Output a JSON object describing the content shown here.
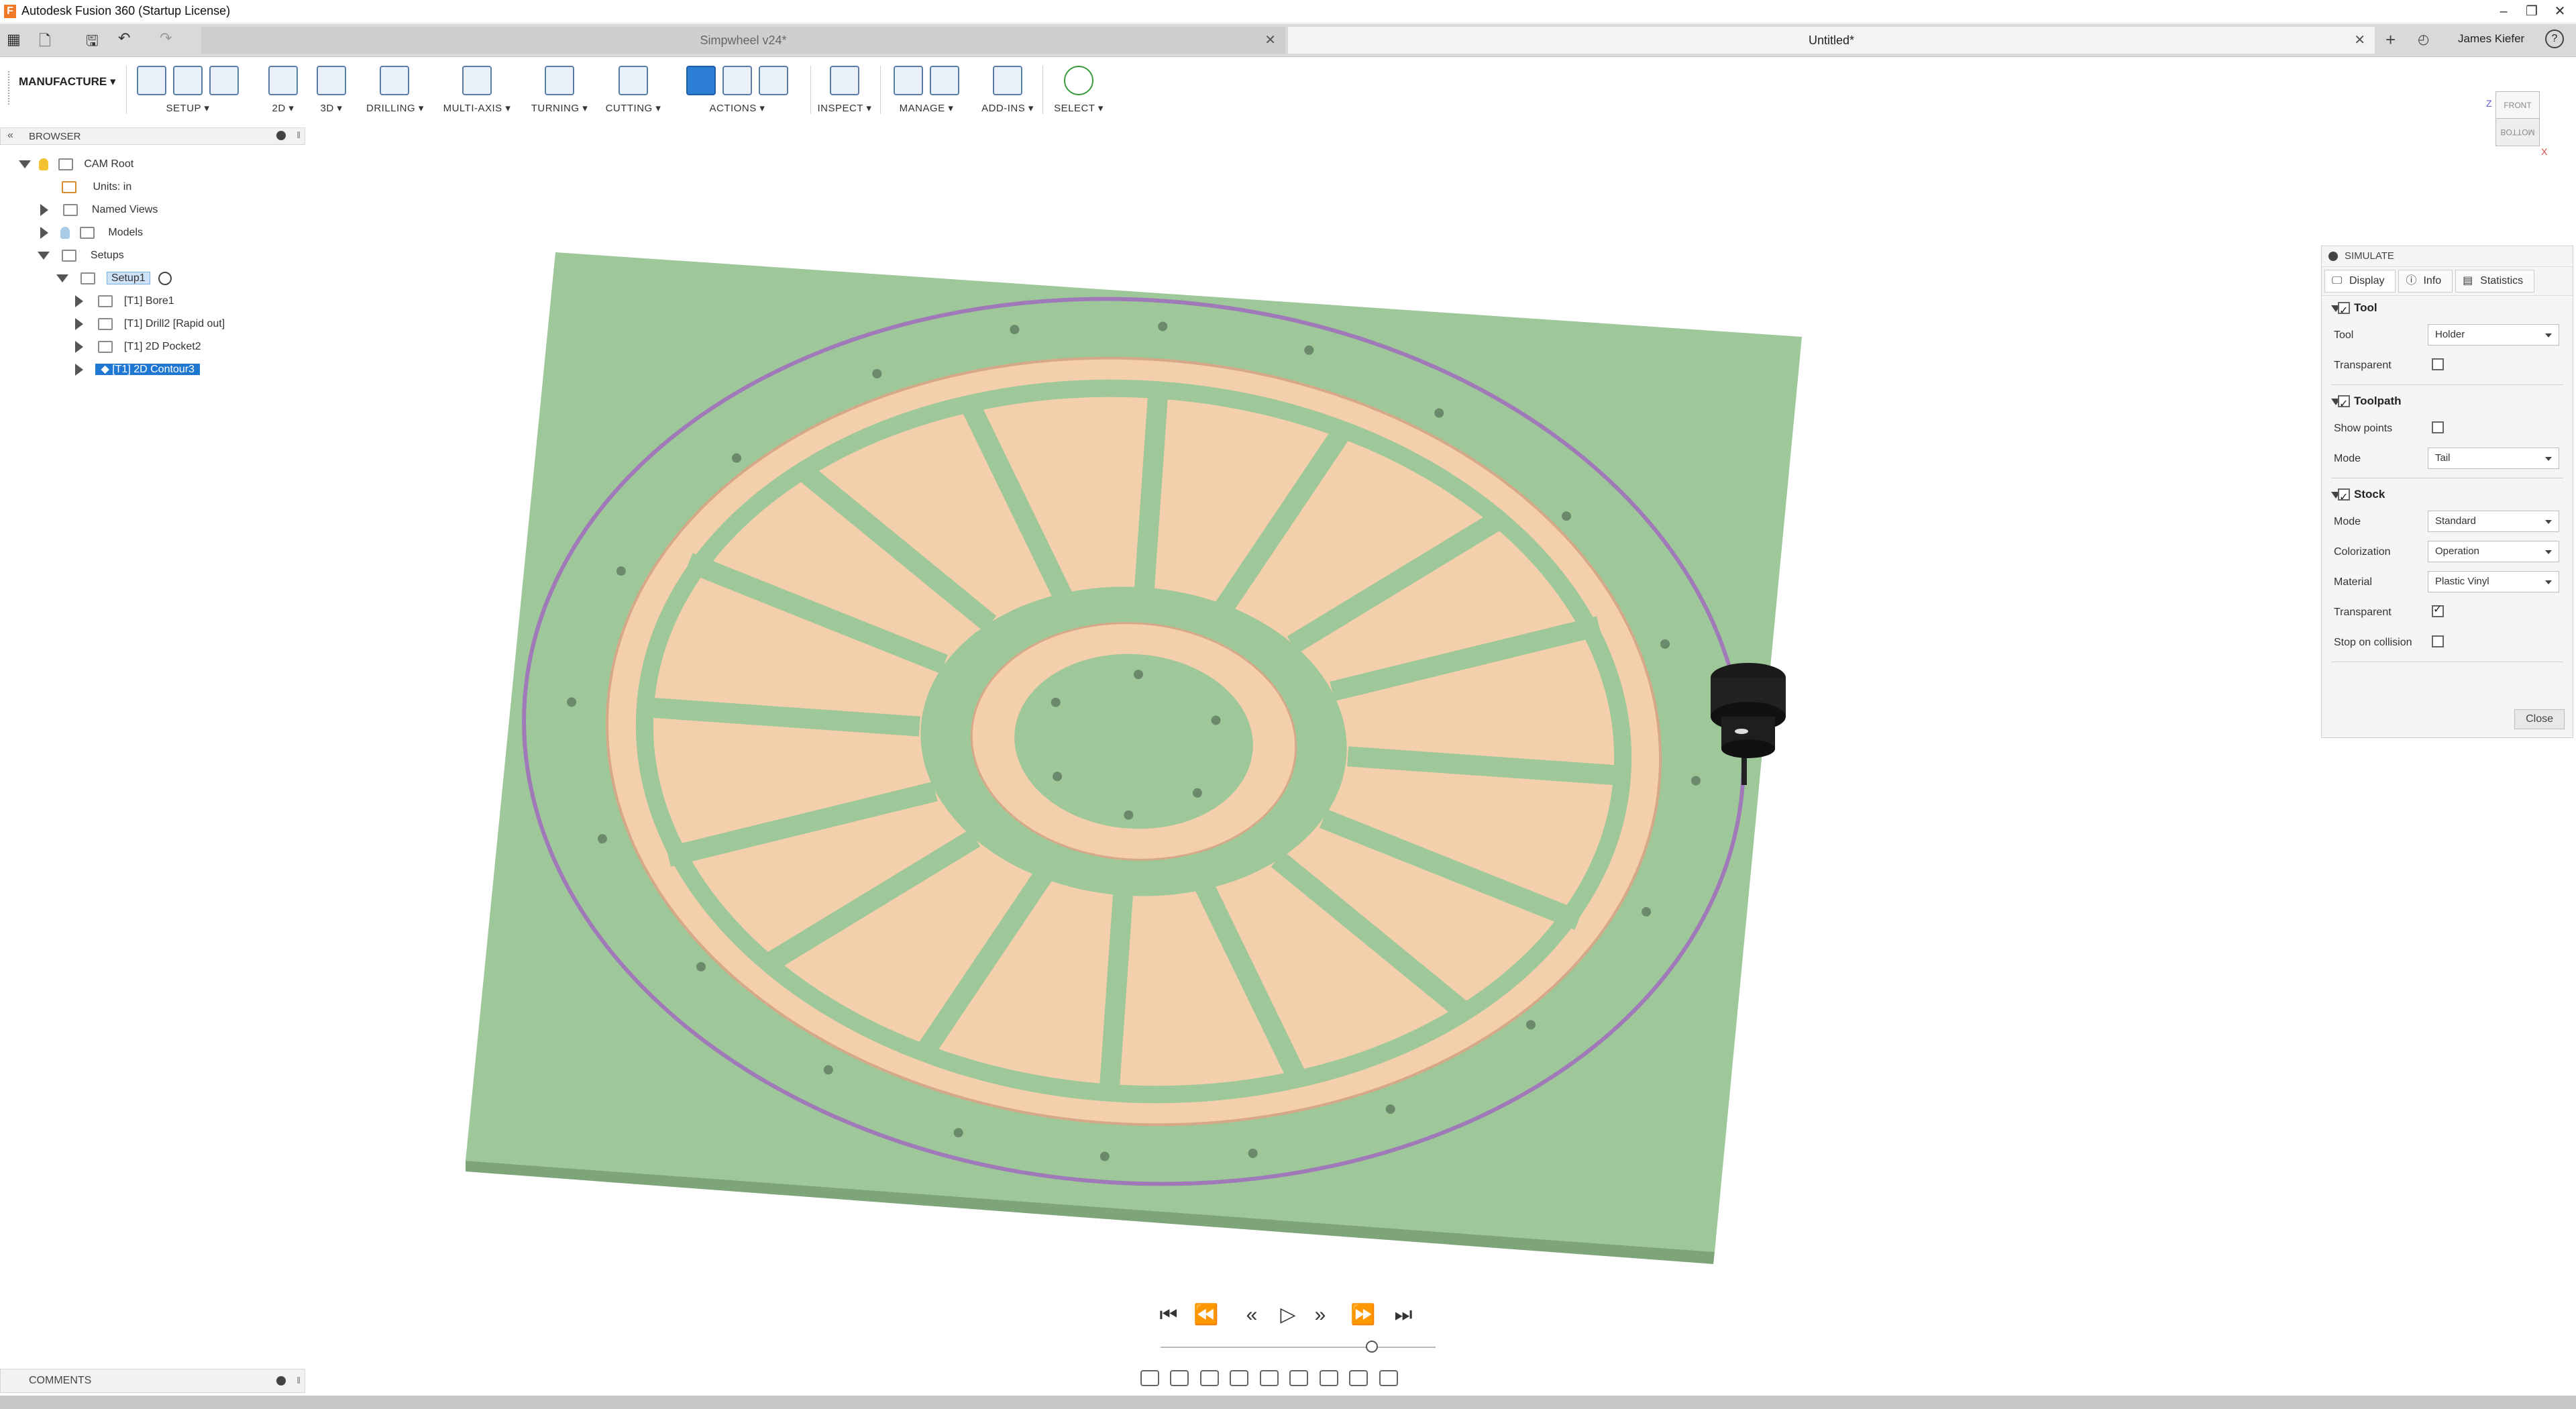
{
  "window": {
    "title": "Autodesk Fusion 360 (Startup License)",
    "app_icon": "F",
    "controls": [
      "–",
      "❐",
      "✕"
    ]
  },
  "tabs": [
    {
      "label": "Simpwheel v24*",
      "close": "✕"
    },
    {
      "label": "Untitled*",
      "close": "✕"
    }
  ],
  "user": {
    "name": "James Kiefer"
  },
  "workspace": {
    "label": "MANUFACTURE"
  },
  "toolbar": {
    "groups": [
      "SETUP",
      "2D",
      "3D",
      "DRILLING",
      "MULTI-AXIS",
      "TURNING",
      "CUTTING",
      "ACTIONS",
      "INSPECT",
      "MANAGE",
      "ADD-INS",
      "SELECT"
    ]
  },
  "browser": {
    "title": "BROWSER",
    "items": [
      {
        "label": "CAM Root"
      },
      {
        "label": "Units: in"
      },
      {
        "label": "Named Views"
      },
      {
        "label": "Models"
      },
      {
        "label": "Setups"
      },
      {
        "label": "Setup1"
      },
      {
        "label": "[T1] Bore1"
      },
      {
        "label": "[T1] Drill2 [Rapid out]"
      },
      {
        "label": "[T1] 2D Pocket2"
      },
      {
        "label": "[T1] 2D Contour3"
      }
    ]
  },
  "viewcube": {
    "front": "FRONT",
    "bottom": "BOTTOM",
    "axis_x": "X",
    "axis_z": "Z"
  },
  "simulate": {
    "title": "SIMULATE",
    "tabs": [
      "Display",
      "Info",
      "Statistics"
    ],
    "tool_section": {
      "title": "Tool",
      "checked": true,
      "tool_label": "Tool",
      "tool_value": "Holder",
      "transparent_label": "Transparent",
      "transparent": false
    },
    "toolpath_section": {
      "title": "Toolpath",
      "checked": true,
      "show_points_label": "Show points",
      "show_points": false,
      "mode_label": "Mode",
      "mode_value": "Tail"
    },
    "stock_section": {
      "title": "Stock",
      "checked": true,
      "mode_label": "Mode",
      "mode_value": "Standard",
      "colorization_label": "Colorization",
      "colorization_value": "Operation",
      "material_label": "Material",
      "material_value": "Plastic Vinyl",
      "transparent_label": "Transparent",
      "transparent": true,
      "stop_label": "Stop on collision",
      "stop": false
    },
    "close_label": "Close"
  },
  "comments": {
    "title": "COMMENTS"
  },
  "colors": {
    "stock_green": "#9dc89a",
    "pocket_orange": "#f5cfac",
    "accent_blue": "#1e78d2"
  }
}
